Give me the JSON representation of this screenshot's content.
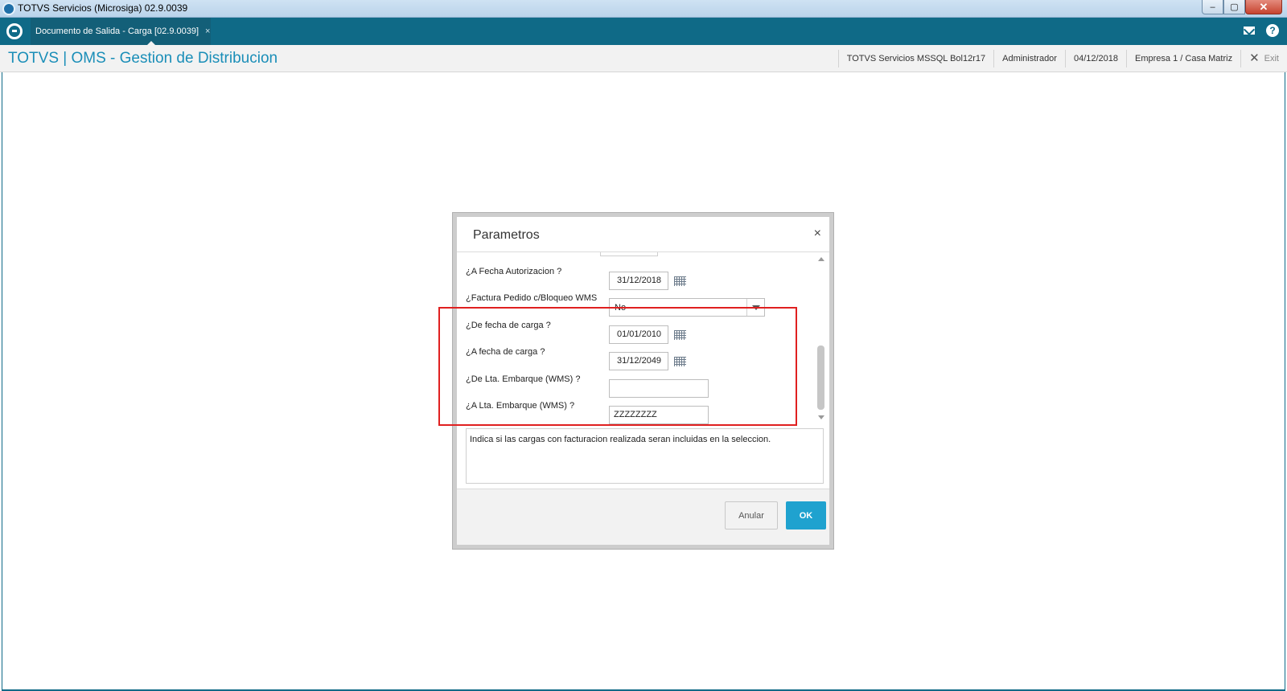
{
  "window": {
    "title": "TOTVS Servicios (Microsiga) 02.9.0039",
    "buttons": {
      "minimize": "–",
      "restore": "▢",
      "close": "✕"
    }
  },
  "tabbar": {
    "tab_label": "Documento de Salida - Carga [02.9.0039]",
    "tab_close": "×",
    "help_label": "?"
  },
  "header": {
    "app_title": "TOTVS | OMS - Gestion de Distribucion",
    "server": "TOTVS Servicios MSSQL Bol12r17",
    "user": "Administrador",
    "date": "04/12/2018",
    "company": "Empresa 1 / Casa Matriz",
    "exit_label": "Exit",
    "exit_icon": "✕"
  },
  "dialog": {
    "title": "Parametros",
    "close": "×",
    "fields": {
      "a_fecha_autorizacion": {
        "label": "¿A Fecha Autorizacion ?",
        "value": "31/12/2018"
      },
      "factura_pedido": {
        "label": "¿Factura Pedido c/Bloqueo WMS",
        "value": "No"
      },
      "de_fecha_carga": {
        "label": "¿De fecha de carga ?",
        "value": "01/01/2010"
      },
      "a_fecha_carga": {
        "label": "¿A fecha de carga ?",
        "value": "31/12/2049"
      },
      "de_lta_embarque": {
        "label": "¿De Lta. Embarque (WMS) ?",
        "value": ""
      },
      "a_lta_embarque": {
        "label": "¿A Lta. Embarque (WMS) ?",
        "value": "ZZZZZZZZ"
      }
    },
    "help_text": "Indica si las cargas con facturacion realizada seran incluidas en la seleccion.",
    "buttons": {
      "cancel": "Anular",
      "ok": "OK"
    }
  },
  "colors": {
    "brand_bar": "#0f6a87",
    "title_accent": "#1a8eb8",
    "ok_button": "#1fa2cf",
    "highlight": "#e02020"
  }
}
